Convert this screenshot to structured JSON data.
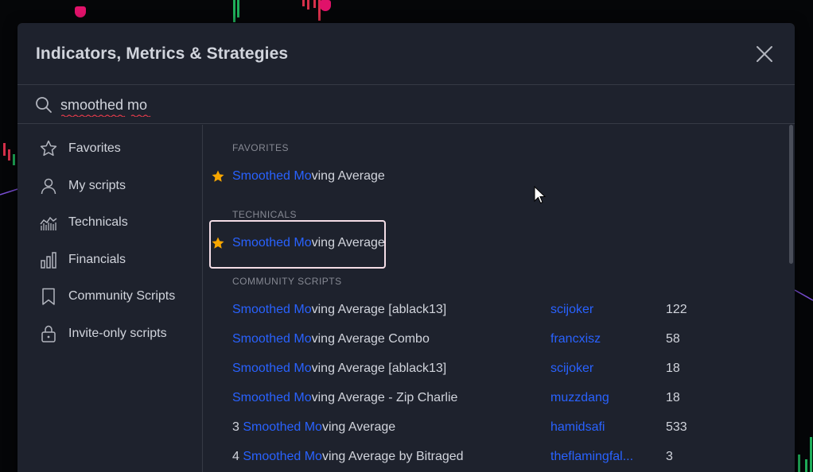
{
  "dialog": {
    "title": "Indicators, Metrics & Strategies"
  },
  "search": {
    "value": "smoothed mo"
  },
  "sidebar": {
    "items": [
      {
        "label": "Favorites",
        "icon": "star-outline-icon"
      },
      {
        "label": "My scripts",
        "icon": "user-icon"
      },
      {
        "label": "Technicals",
        "icon": "chart-area-icon"
      },
      {
        "label": "Financials",
        "icon": "bar-chart-icon"
      },
      {
        "label": "Community Scripts",
        "icon": "bookmark-icon"
      },
      {
        "label": "Invite-only scripts",
        "icon": "lock-icon"
      }
    ]
  },
  "results": {
    "favorites_header": "FAVORITES",
    "technicals_header": "TECHNICALS",
    "community_header": "COMMUNITY SCRIPTS",
    "favorites": [
      {
        "match": "Smoothed Mo",
        "rest": "ving Average"
      }
    ],
    "technicals": [
      {
        "match": "Smoothed Mo",
        "rest": "ving Average"
      }
    ],
    "community": [
      {
        "prefix": "",
        "match": "Smoothed Mo",
        "rest": "ving Average [ablack13]",
        "author": "scijoker",
        "count": "122"
      },
      {
        "prefix": "",
        "match": "Smoothed Mo",
        "rest": "ving Average Combo",
        "author": "francxisz",
        "count": "58"
      },
      {
        "prefix": "",
        "match": "Smoothed Mo",
        "rest": "ving Average [ablack13]",
        "author": "scijoker",
        "count": "18"
      },
      {
        "prefix": "",
        "match": "Smoothed Mo",
        "rest": "ving Average - Zip Charlie",
        "author": "muzzdang",
        "count": "18"
      },
      {
        "prefix": "3 ",
        "match": "Smoothed Mo",
        "rest": "ving Average",
        "author": "hamidsafi",
        "count": "533"
      },
      {
        "prefix": "4 ",
        "match": "Smoothed Mo",
        "rest": "ving Average by Bitraged",
        "author": "theflamingfal...",
        "count": "3"
      }
    ]
  },
  "colors": {
    "dialog_bg": "#1e222d",
    "text": "#d1d4dc",
    "accent_blue": "#2962ff",
    "star": "#f7a600",
    "muted": "#868993",
    "highlight_box": "#f4dde6"
  }
}
